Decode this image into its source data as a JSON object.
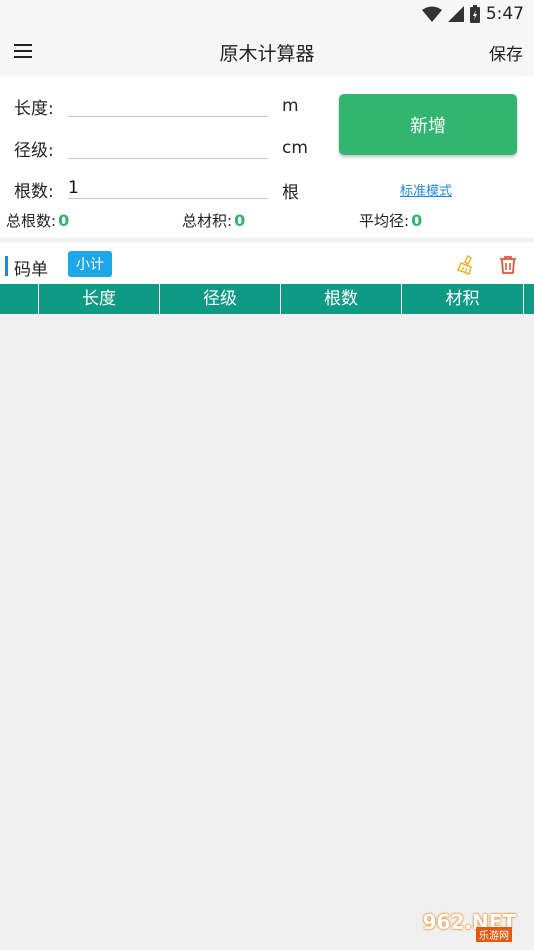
{
  "status": {
    "time": "5:47"
  },
  "appbar": {
    "title": "原木计算器",
    "save_label": "保存"
  },
  "form": {
    "length_label": "长度:",
    "length_value": "",
    "length_unit": "m",
    "diameter_label": "径级:",
    "diameter_value": "",
    "diameter_unit": "cm",
    "count_label": "根数:",
    "count_value": "1",
    "count_unit": "根",
    "add_button": "新增",
    "mode_link": "标准模式"
  },
  "stats": {
    "total_count_label": "总根数:",
    "total_count_value": "0",
    "total_volume_label": "总材积:",
    "total_volume_value": "0",
    "avg_diameter_label": "平均径:",
    "avg_diameter_value": "0"
  },
  "list": {
    "title": "码单",
    "subtotal_button": "小计",
    "columns": [
      "",
      "长度",
      "径级",
      "根数",
      "材积",
      ""
    ]
  },
  "watermark": {
    "main": "962.NET",
    "sub": "乐游网"
  },
  "colors": {
    "accent_green": "#32b56e",
    "header_teal": "#0f9a86",
    "link_blue": "#1e8ad6",
    "delete_red": "#e0553a",
    "clear_yellow": "#e9b32b"
  }
}
